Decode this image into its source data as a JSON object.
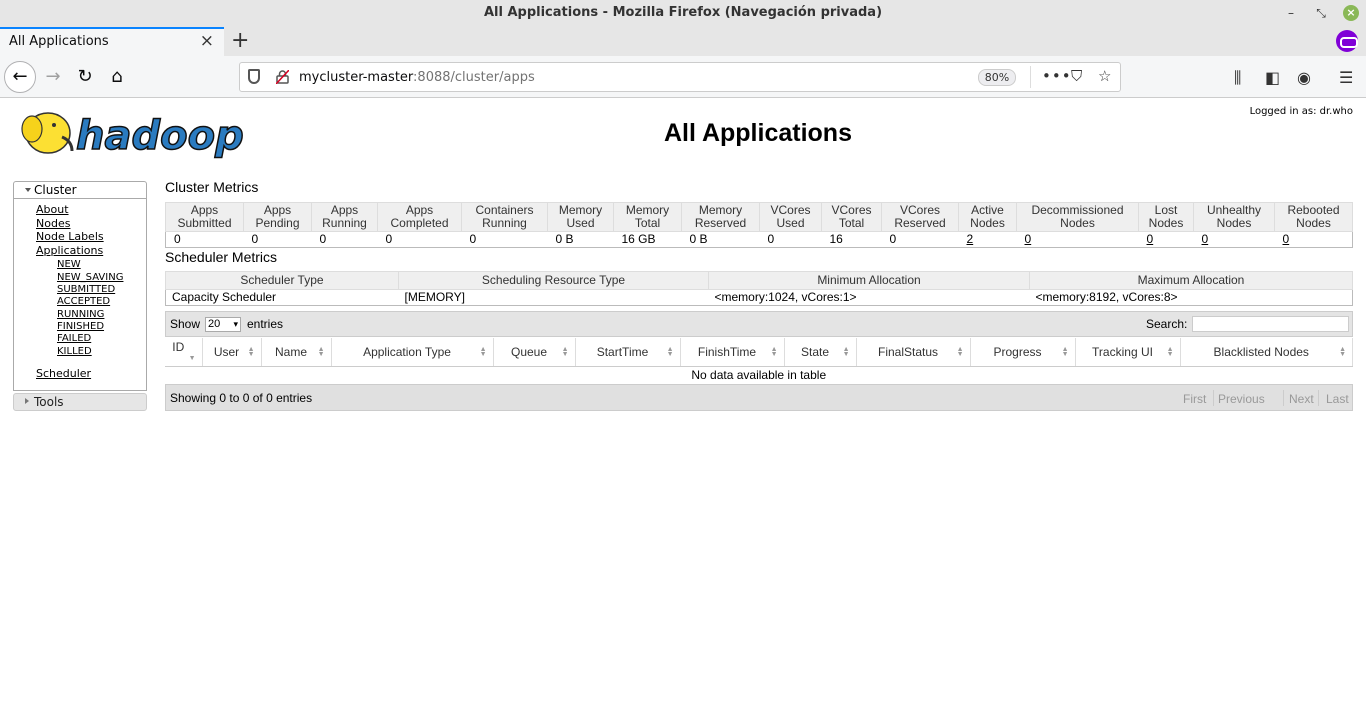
{
  "window": {
    "title": "All Applications - Mozilla Firefox (Navegación privada)"
  },
  "browser": {
    "tab_label": "All Applications",
    "url_host": "mycluster-master",
    "url_rest": ":8088/cluster/apps",
    "zoom": "80%"
  },
  "page": {
    "logo_text": "hadoop",
    "logged_in": "Logged in as: dr.who",
    "title": "All Applications"
  },
  "sidebar": {
    "cluster_label": "Cluster",
    "links": [
      "About",
      "Nodes",
      "Node Labels",
      "Applications"
    ],
    "app_states": [
      "NEW",
      "NEW_SAVING",
      "SUBMITTED",
      "ACCEPTED",
      "RUNNING",
      "FINISHED",
      "FAILED",
      "KILLED"
    ],
    "scheduler": "Scheduler",
    "tools_label": "Tools"
  },
  "cluster_metrics": {
    "title": "Cluster Metrics",
    "headers": [
      [
        "Apps",
        "Submitted"
      ],
      [
        "Apps",
        "Pending"
      ],
      [
        "Apps",
        "Running"
      ],
      [
        "Apps",
        "Completed"
      ],
      [
        "Containers",
        "Running"
      ],
      [
        "Memory",
        "Used"
      ],
      [
        "Memory",
        "Total"
      ],
      [
        "Memory",
        "Reserved"
      ],
      [
        "VCores",
        "Used"
      ],
      [
        "VCores",
        "Total"
      ],
      [
        "VCores",
        "Reserved"
      ],
      [
        "Active",
        "Nodes"
      ],
      [
        "Decommissioned",
        "Nodes"
      ],
      [
        "Lost",
        "Nodes"
      ],
      [
        "Unhealthy",
        "Nodes"
      ],
      [
        "Rebooted",
        "Nodes"
      ]
    ],
    "values": [
      "0",
      "0",
      "0",
      "0",
      "0",
      "0 B",
      "16 GB",
      "0 B",
      "0",
      "16",
      "0",
      "2",
      "0",
      "0",
      "0",
      "0"
    ]
  },
  "scheduler_metrics": {
    "title": "Scheduler Metrics",
    "headers": [
      "Scheduler Type",
      "Scheduling Resource Type",
      "Minimum Allocation",
      "Maximum Allocation"
    ],
    "values": [
      "Capacity Scheduler",
      "[MEMORY]",
      "<memory:1024, vCores:1>",
      "<memory:8192, vCores:8>"
    ]
  },
  "apps_table": {
    "show_label": "Show",
    "page_size": "20",
    "entries_label": "entries",
    "search_label": "Search:",
    "columns": [
      "ID",
      "User",
      "Name",
      "Application Type",
      "Queue",
      "StartTime",
      "FinishTime",
      "State",
      "FinalStatus",
      "Progress",
      "Tracking UI",
      "Blacklisted Nodes"
    ],
    "empty_message": "No data available in table",
    "info": "Showing 0 to 0 of 0 entries",
    "pager": [
      "First",
      "Previous",
      "Next",
      "Last"
    ]
  }
}
